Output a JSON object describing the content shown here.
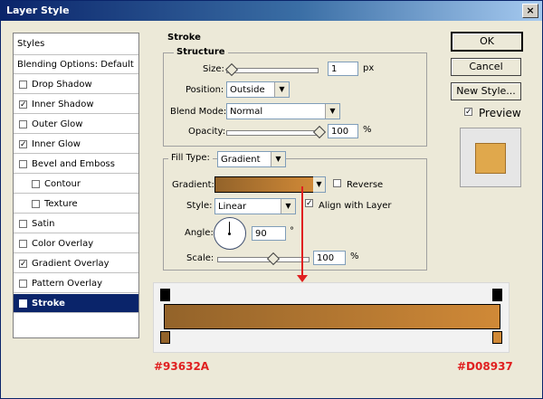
{
  "window": {
    "title": "Layer Style",
    "close_glyph": "×"
  },
  "styles_list": {
    "header": "Styles",
    "items": [
      {
        "label": "Blending Options: Default",
        "checkbox": false,
        "checked": false,
        "indent": false
      },
      {
        "label": "Drop Shadow",
        "checkbox": true,
        "checked": false,
        "indent": false
      },
      {
        "label": "Inner Shadow",
        "checkbox": true,
        "checked": true,
        "indent": false
      },
      {
        "label": "Outer Glow",
        "checkbox": true,
        "checked": false,
        "indent": false
      },
      {
        "label": "Inner Glow",
        "checkbox": true,
        "checked": true,
        "indent": false
      },
      {
        "label": "Bevel and Emboss",
        "checkbox": true,
        "checked": false,
        "indent": false
      },
      {
        "label": "Contour",
        "checkbox": true,
        "checked": false,
        "indent": true
      },
      {
        "label": "Texture",
        "checkbox": true,
        "checked": false,
        "indent": true
      },
      {
        "label": "Satin",
        "checkbox": true,
        "checked": false,
        "indent": false
      },
      {
        "label": "Color Overlay",
        "checkbox": true,
        "checked": false,
        "indent": false
      },
      {
        "label": "Gradient Overlay",
        "checkbox": true,
        "checked": true,
        "indent": false
      },
      {
        "label": "Pattern Overlay",
        "checkbox": true,
        "checked": false,
        "indent": false
      },
      {
        "label": "Stroke",
        "checkbox": true,
        "checked": true,
        "indent": false,
        "selected": true
      }
    ]
  },
  "stroke": {
    "title": "Stroke",
    "structure": {
      "title": "Structure",
      "size_label": "Size:",
      "size_value": "1",
      "size_unit": "px",
      "position_label": "Position:",
      "position_value": "Outside",
      "blend_label": "Blend Mode:",
      "blend_value": "Normal",
      "opacity_label": "Opacity:",
      "opacity_value": "100",
      "opacity_unit": "%"
    },
    "fill": {
      "fill_type_label": "Fill Type:",
      "fill_type_value": "Gradient",
      "gradient_label": "Gradient:",
      "reverse_label": "Reverse",
      "reverse_checked": false,
      "style_label": "Style:",
      "style_value": "Linear",
      "align_label": "Align with Layer",
      "align_checked": true,
      "angle_label": "Angle:",
      "angle_value": "90",
      "angle_unit": "°",
      "scale_label": "Scale:",
      "scale_value": "100",
      "scale_unit": "%"
    }
  },
  "buttons": {
    "ok": "OK",
    "cancel": "Cancel",
    "new_style": "New Style..."
  },
  "preview": {
    "label": "Preview",
    "checked": true
  },
  "gradient": {
    "start_color": "#93632A",
    "end_color": "#D08937",
    "start_label": "#93632A",
    "end_label": "#D08937"
  },
  "glyphs": {
    "check": "✓",
    "arrow": "▼"
  }
}
